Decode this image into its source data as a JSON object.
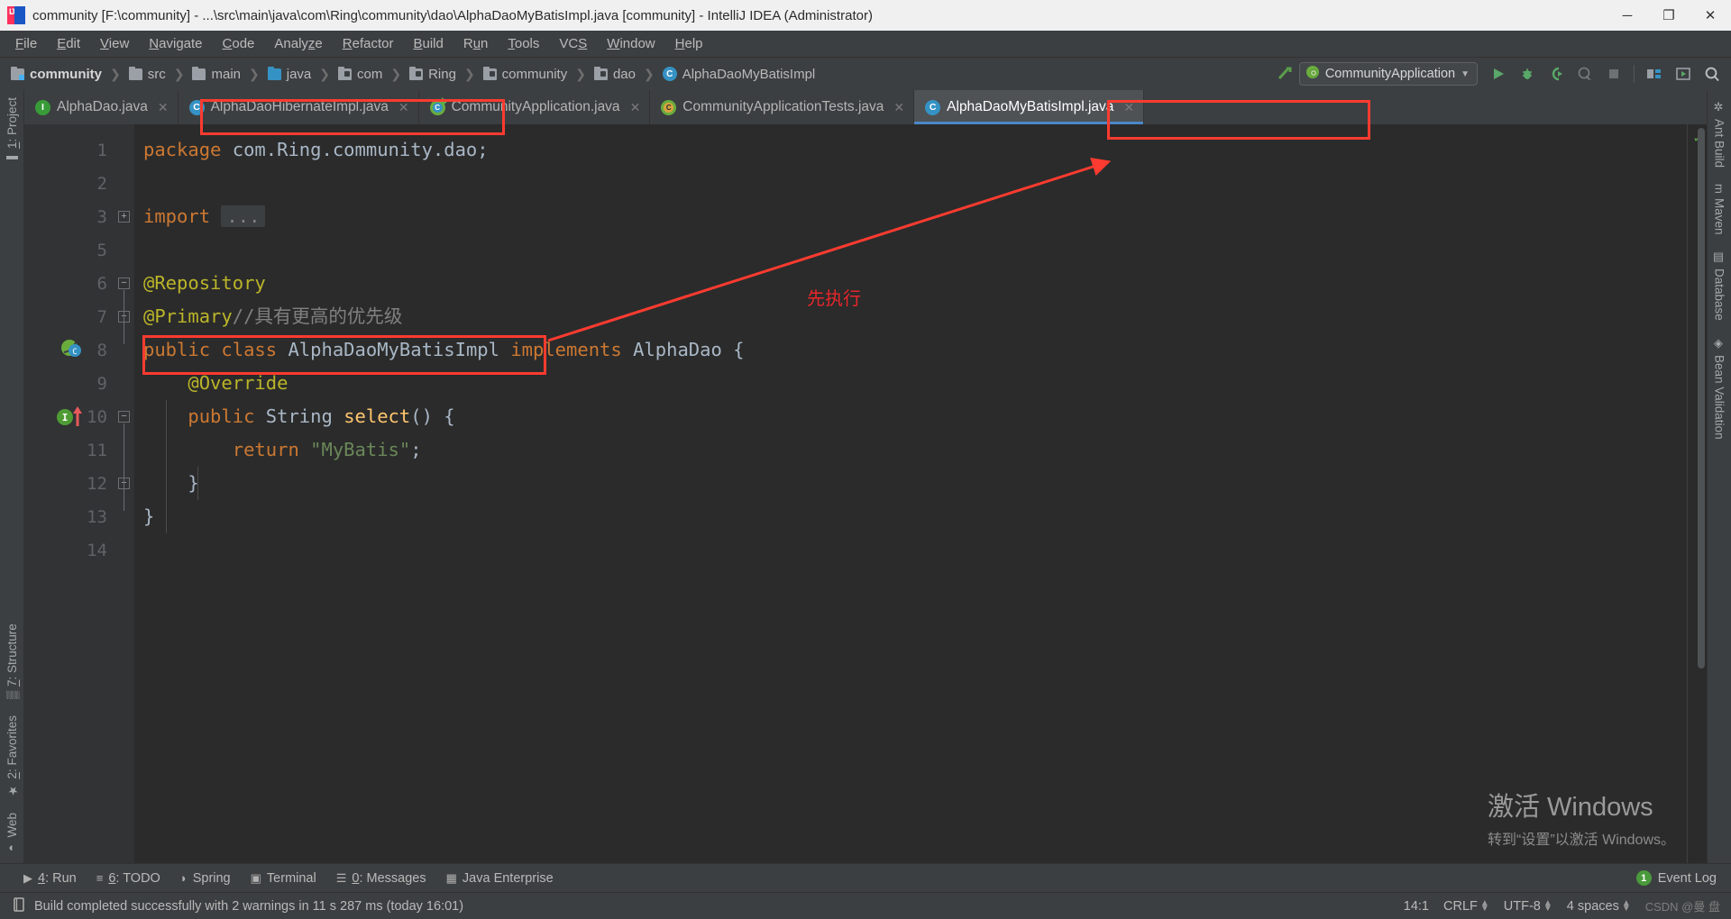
{
  "window": {
    "title": "community [F:\\community] - ...\\src\\main\\java\\com\\Ring\\community\\dao\\AlphaDaoMyBatisImpl.java [community] - IntelliJ IDEA (Administrator)",
    "logo_text": "IJ",
    "minimize": "─",
    "maximize": "❐",
    "close": "✕"
  },
  "menu": [
    {
      "label": "File",
      "mnemonic": "F"
    },
    {
      "label": "Edit",
      "mnemonic": "E"
    },
    {
      "label": "View",
      "mnemonic": "V"
    },
    {
      "label": "Navigate",
      "mnemonic": "N"
    },
    {
      "label": "Code",
      "mnemonic": "C"
    },
    {
      "label": "Analyze",
      "mnemonic": "z"
    },
    {
      "label": "Refactor",
      "mnemonic": "R"
    },
    {
      "label": "Build",
      "mnemonic": "B"
    },
    {
      "label": "Run",
      "mnemonic": "u"
    },
    {
      "label": "Tools",
      "mnemonic": "T"
    },
    {
      "label": "VCS",
      "mnemonic": "S"
    },
    {
      "label": "Window",
      "mnemonic": "W"
    },
    {
      "label": "Help",
      "mnemonic": "H"
    }
  ],
  "breadcrumb": [
    {
      "label": "community",
      "icon": "module-folder-icon",
      "bold": true
    },
    {
      "label": "src",
      "icon": "folder-icon",
      "bold": false
    },
    {
      "label": "main",
      "icon": "folder-icon",
      "bold": false
    },
    {
      "label": "java",
      "icon": "source-folder-icon",
      "bold": false
    },
    {
      "label": "com",
      "icon": "package-icon",
      "bold": false
    },
    {
      "label": "Ring",
      "icon": "package-icon",
      "bold": false
    },
    {
      "label": "community",
      "icon": "package-icon",
      "bold": false
    },
    {
      "label": "dao",
      "icon": "package-icon",
      "bold": false
    },
    {
      "label": "AlphaDaoMyBatisImpl",
      "icon": "class-icon",
      "bold": false
    }
  ],
  "toolbar": {
    "run_config": "CommunityApplication",
    "dropdown_caret": "▼",
    "icons": [
      {
        "name": "build-hammer-icon",
        "glyph": "⬉"
      },
      {
        "name": "run-icon",
        "glyph": "▶"
      },
      {
        "name": "debug-icon",
        "glyph": "🐞"
      },
      {
        "name": "run-with-coverage-icon",
        "glyph": "▷"
      },
      {
        "name": "profile-icon",
        "glyph": "◌"
      },
      {
        "name": "stop-icon",
        "glyph": "■"
      },
      {
        "name": "project-structure-icon",
        "glyph": "▤"
      },
      {
        "name": "update-project-icon",
        "glyph": "▣"
      },
      {
        "name": "search-everywhere-icon",
        "glyph": "🔍"
      }
    ]
  },
  "editor_tabs": [
    {
      "label": "AlphaDao.java",
      "icon": "interface-icon",
      "icon_letter": "I",
      "kind": "iface",
      "active": false,
      "closable": true
    },
    {
      "label": "AlphaDaoHibernateImpl.java",
      "icon": "class-icon",
      "icon_letter": "C",
      "kind": "cls",
      "active": false,
      "closable": true
    },
    {
      "label": "CommunityApplication.java",
      "icon": "spring-boot-class-icon",
      "icon_letter": "C",
      "kind": "spring",
      "active": false,
      "closable": true
    },
    {
      "label": "CommunityApplicationTests.java",
      "icon": "spring-test-class-icon",
      "icon_letter": "C",
      "kind": "springtest",
      "active": false,
      "closable": true
    },
    {
      "label": "AlphaDaoMyBatisImpl.java",
      "icon": "class-icon",
      "icon_letter": "C",
      "kind": "cls",
      "active": true,
      "closable": true
    }
  ],
  "left_strip": [
    {
      "label": "1: Project",
      "mnemonic": "1",
      "icon": "project-folder-icon",
      "glyph": "▬"
    },
    {
      "label": "7: Structure",
      "mnemonic": "7",
      "icon": "structure-icon",
      "glyph": "▒"
    },
    {
      "label": "2: Favorites",
      "mnemonic": "2",
      "icon": "star-icon",
      "glyph": "★"
    },
    {
      "label": "Web",
      "mnemonic": "",
      "icon": "web-globe-icon",
      "glyph": "◑"
    }
  ],
  "right_strip": [
    {
      "label": "Ant Build",
      "icon": "ant-icon",
      "glyph": "✲"
    },
    {
      "label": "Maven",
      "icon": "maven-icon",
      "glyph": "m"
    },
    {
      "label": "Database",
      "icon": "database-icon",
      "glyph": "▤"
    },
    {
      "label": "Bean Validation",
      "icon": "bean-validation-icon",
      "glyph": "◈"
    }
  ],
  "code": {
    "line_numbers": [
      "1",
      "2",
      "3",
      "5",
      "6",
      "7",
      "8",
      "9",
      "10",
      "11",
      "12",
      "13",
      "14"
    ],
    "lines": [
      {
        "n": "1",
        "tokens": [
          {
            "t": "package ",
            "c": "k"
          },
          {
            "t": "com.Ring.community.dao",
            "c": "ty"
          },
          {
            "t": ";",
            "c": "p"
          }
        ]
      },
      {
        "n": "2",
        "tokens": []
      },
      {
        "n": "3",
        "tokens": [
          {
            "t": "import ",
            "c": "k"
          },
          {
            "t": "...",
            "c": "fold"
          }
        ]
      },
      {
        "n": "5",
        "tokens": []
      },
      {
        "n": "6",
        "tokens": [
          {
            "t": "@Repository",
            "c": "an"
          }
        ]
      },
      {
        "n": "7",
        "tokens": [
          {
            "t": "@Primary",
            "c": "an"
          },
          {
            "t": "//具有更高的优先级",
            "c": "cm"
          }
        ]
      },
      {
        "n": "8",
        "tokens": [
          {
            "t": "public ",
            "c": "k"
          },
          {
            "t": "class ",
            "c": "k"
          },
          {
            "t": "AlphaDaoMyBatisImpl ",
            "c": "ty"
          },
          {
            "t": "implements ",
            "c": "k"
          },
          {
            "t": "AlphaDao ",
            "c": "ty"
          },
          {
            "t": "{",
            "c": "p"
          }
        ]
      },
      {
        "n": "9",
        "tokens": [
          {
            "t": "    @Override",
            "c": "an"
          }
        ]
      },
      {
        "n": "10",
        "tokens": [
          {
            "t": "    ",
            "c": "p"
          },
          {
            "t": "public ",
            "c": "k"
          },
          {
            "t": "String ",
            "c": "ty"
          },
          {
            "t": "select",
            "c": "fn"
          },
          {
            "t": "() {",
            "c": "p"
          }
        ]
      },
      {
        "n": "11",
        "tokens": [
          {
            "t": "        ",
            "c": "p"
          },
          {
            "t": "return ",
            "c": "k"
          },
          {
            "t": "\"MyBatis\"",
            "c": "st"
          },
          {
            "t": ";",
            "c": "p"
          }
        ]
      },
      {
        "n": "12",
        "tokens": [
          {
            "t": "    }",
            "c": "p"
          }
        ]
      },
      {
        "n": "13",
        "tokens": [
          {
            "t": "}",
            "c": "p"
          }
        ]
      },
      {
        "n": "14",
        "tokens": []
      }
    ],
    "gutter_marks": [
      {
        "line": "8",
        "name": "spring-bean-gutter-icon",
        "letter": "C"
      },
      {
        "line": "10",
        "name": "implementing-method-gutter-icon",
        "letter": "I"
      }
    ],
    "folds": [
      {
        "line": "3",
        "type": "plus"
      },
      {
        "line": "6",
        "type": "minus"
      },
      {
        "line": "7",
        "type": "minus"
      },
      {
        "line": "10",
        "type": "minus"
      },
      {
        "line": "12",
        "type": "minus"
      }
    ]
  },
  "annotations": {
    "text": "先执行",
    "color": "#e8262a",
    "boxes": [
      "editor-tab-hibernate-impl",
      "primary-annotation-line",
      "active-tab-mybatis-impl"
    ]
  },
  "watermark": {
    "line1": "激活 Windows",
    "line2": "转到“设置”以激活 Windows。"
  },
  "bottom_bar": {
    "items": [
      {
        "label": "4: Run",
        "mnemonic": "4",
        "icon": "run-triangle-icon",
        "glyph": "▶"
      },
      {
        "label": "6: TODO",
        "mnemonic": "6",
        "icon": "todo-list-icon",
        "glyph": "≡"
      },
      {
        "label": "Spring",
        "mnemonic": "",
        "icon": "spring-leaf-icon",
        "glyph": "◗"
      },
      {
        "label": "Terminal",
        "mnemonic": "",
        "icon": "terminal-icon",
        "glyph": "▣"
      },
      {
        "label": "0: Messages",
        "mnemonic": "0",
        "icon": "messages-icon",
        "glyph": "☰"
      },
      {
        "label": "Java Enterprise",
        "mnemonic": "",
        "icon": "java-enterprise-icon",
        "glyph": "▦"
      }
    ],
    "event_log": {
      "label": "Event Log",
      "badge": "1"
    }
  },
  "status_bar": {
    "message": "Build completed successfully with 2 warnings in 11 s 287 ms (today 16:01)",
    "message_icon": "build-status-icon",
    "caret_position": "14:1",
    "line_separator": "CRLF",
    "encoding": "UTF-8",
    "indent": "4 spaces",
    "watermark_text": "CSDN @曼 盘"
  }
}
